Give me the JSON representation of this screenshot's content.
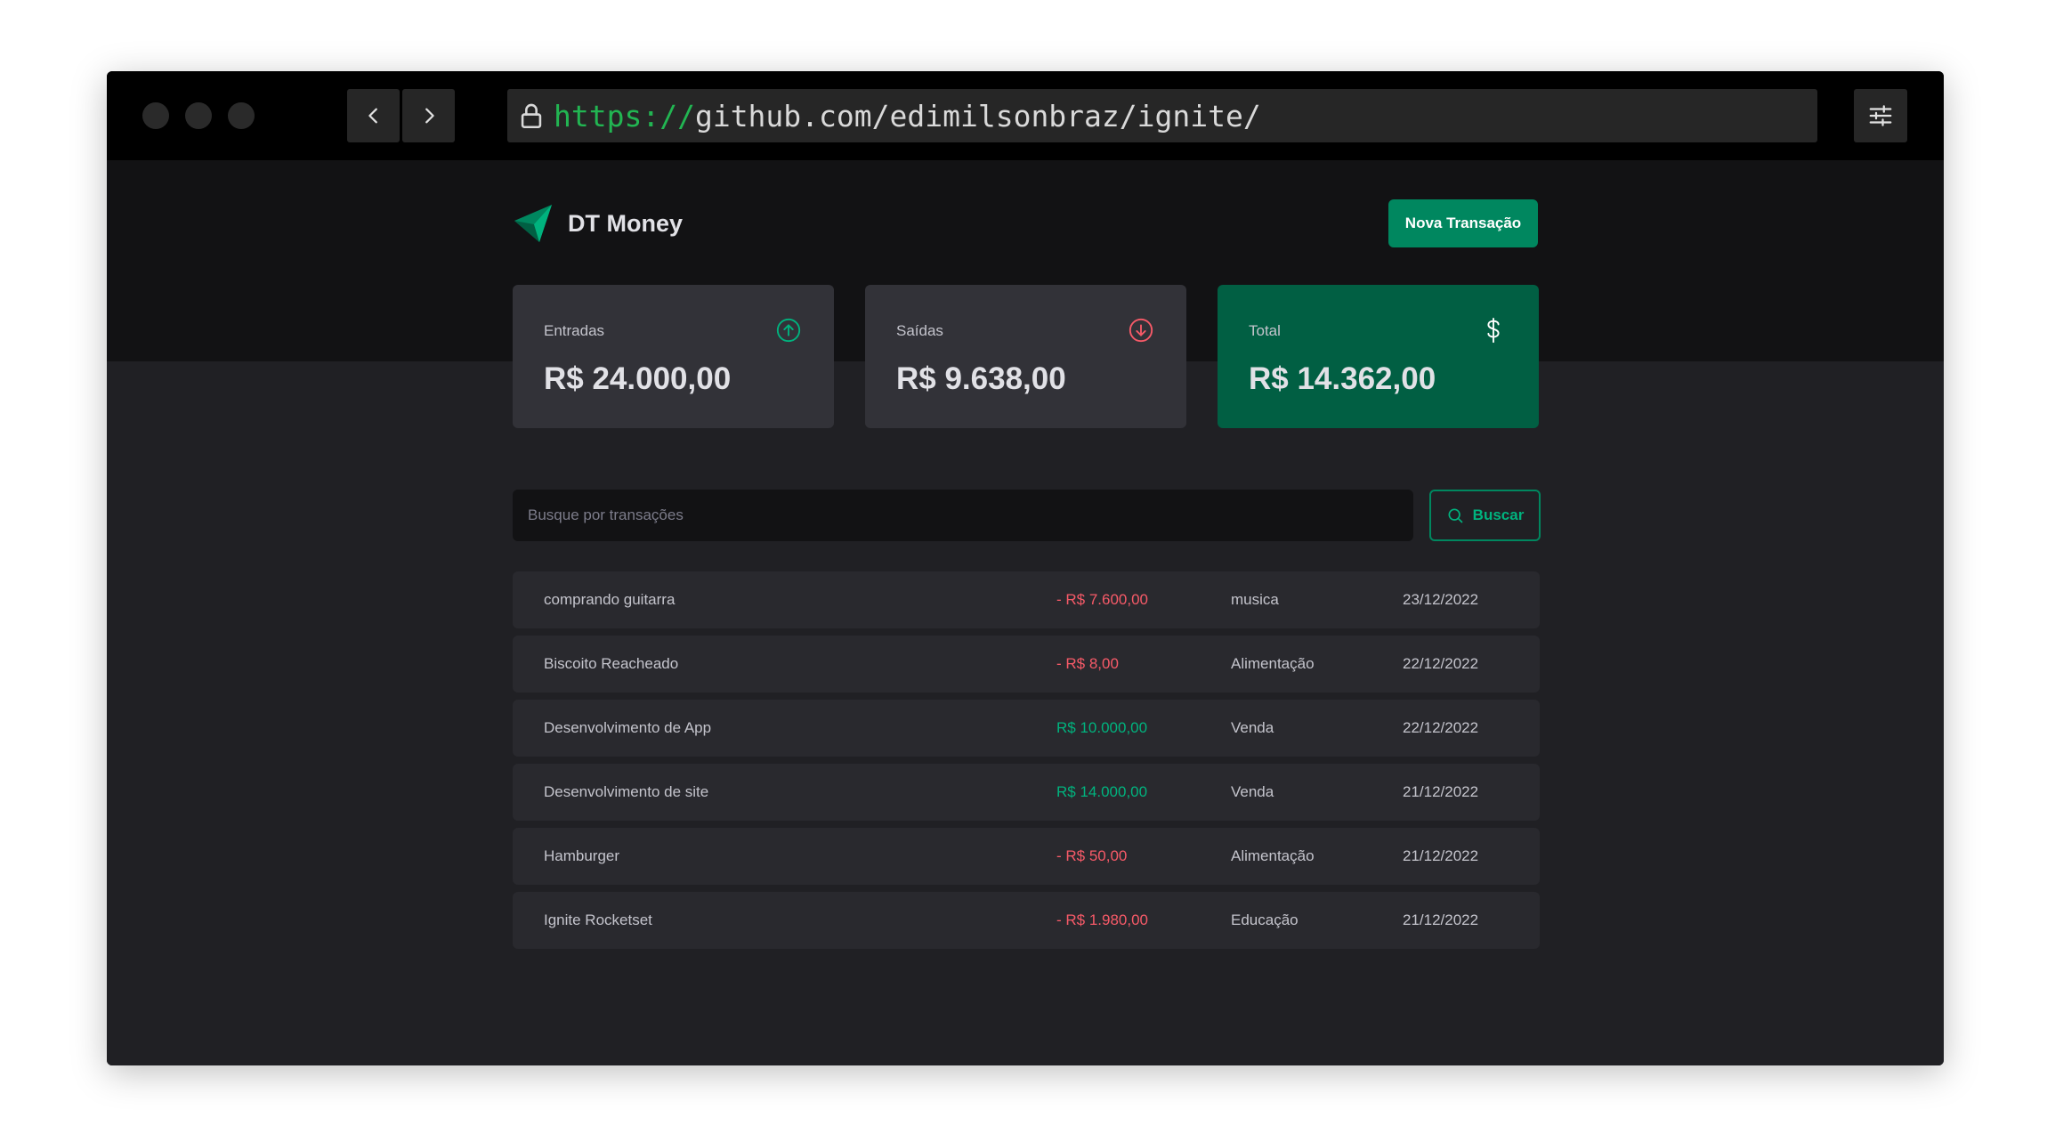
{
  "browser": {
    "url_protocol": "https://",
    "url_rest": "github.com/edimilsonbraz/ignite/"
  },
  "app": {
    "name": "DT Money",
    "new_transaction_label": "Nova Transação"
  },
  "summary": {
    "income": {
      "label": "Entradas",
      "value": "R$ 24.000,00",
      "icon": "arrow-circle-up-icon",
      "color": "#00b37e"
    },
    "outcome": {
      "label": "Saídas",
      "value": "R$ 9.638,00",
      "icon": "arrow-circle-down-icon",
      "color": "#f75a68"
    },
    "total": {
      "label": "Total",
      "value": "R$ 14.362,00",
      "icon": "currency-dollar-icon",
      "color": "#015f43"
    }
  },
  "search": {
    "placeholder": "Busque por transações",
    "button_label": "Buscar"
  },
  "transactions": [
    {
      "description": "comprando guitarra",
      "amount": "- R$ 7.600,00",
      "type": "outcome",
      "category": "musica",
      "date": "23/12/2022"
    },
    {
      "description": "Biscoito Reacheado",
      "amount": "- R$ 8,00",
      "type": "outcome",
      "category": "Alimentação",
      "date": "22/12/2022"
    },
    {
      "description": "Desenvolvimento de App",
      "amount": "R$ 10.000,00",
      "type": "income",
      "category": "Venda",
      "date": "22/12/2022"
    },
    {
      "description": "Desenvolvimento de site",
      "amount": "R$ 14.000,00",
      "type": "income",
      "category": "Venda",
      "date": "21/12/2022"
    },
    {
      "description": "Hamburger",
      "amount": "- R$ 50,00",
      "type": "outcome",
      "category": "Alimentação",
      "date": "21/12/2022"
    },
    {
      "description": "Ignite Rocketset",
      "amount": "- R$ 1.980,00",
      "type": "outcome",
      "category": "Educação",
      "date": "21/12/2022"
    }
  ],
  "colors": {
    "brand_green": "#00875f",
    "green_light": "#00b37e",
    "red": "#f75a68"
  }
}
